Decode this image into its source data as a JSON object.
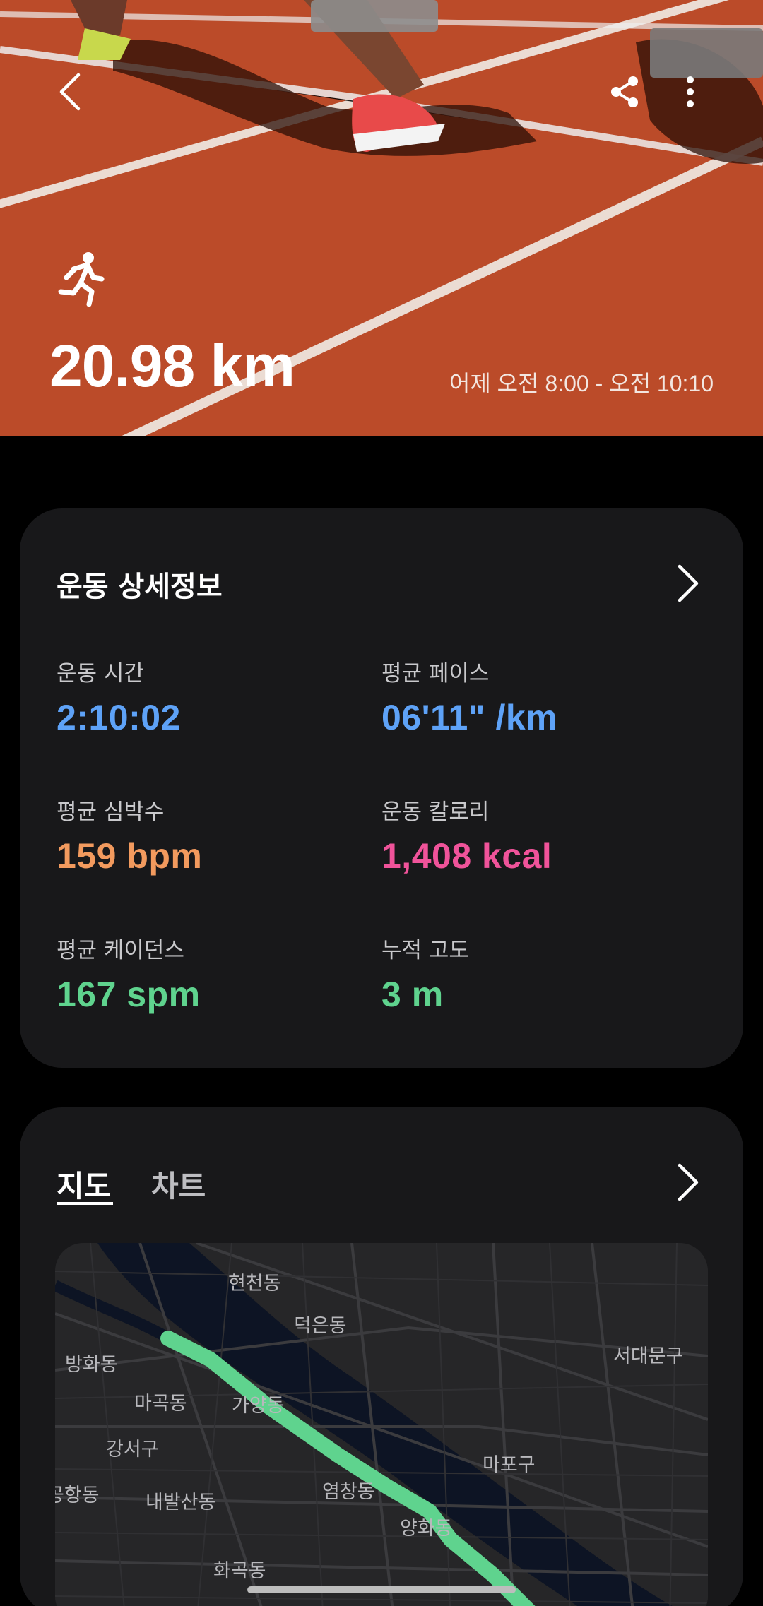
{
  "hero": {
    "distance": "20.98 km",
    "time_range": "어제 오전 8:00 - 오전 10:10",
    "activity_icon": "running-icon",
    "back_icon": "back-arrow-icon",
    "share_icon": "share-icon",
    "more_icon": "more-vertical-icon"
  },
  "details": {
    "title": "운동 상세정보",
    "stats": [
      {
        "label": "운동 시간",
        "value": "2:10:02",
        "color": "#5ea2f7"
      },
      {
        "label": "평균 페이스",
        "value": "06'11\" /km",
        "color": "#5ea2f7"
      },
      {
        "label": "평균 심박수",
        "value": "159 bpm",
        "color": "#f29a5e"
      },
      {
        "label": "운동 칼로리",
        "value": "1,408 kcal",
        "color": "#f0539a"
      },
      {
        "label": "평균 케이던스",
        "value": "167 spm",
        "color": "#5fd38e"
      },
      {
        "label": "누적 고도",
        "value": "3 m",
        "color": "#5fd38e"
      }
    ]
  },
  "map_card": {
    "tabs": [
      {
        "label": "지도"
      },
      {
        "label": "차트"
      }
    ],
    "route_color": "#5fd38e",
    "places": [
      "현천동",
      "덕은동",
      "방화동",
      "서대문구",
      "마곡동",
      "가양동",
      "강서구",
      "마포구",
      "염창동",
      "공항동",
      "내발산동",
      "양화동",
      "화곡동"
    ]
  }
}
